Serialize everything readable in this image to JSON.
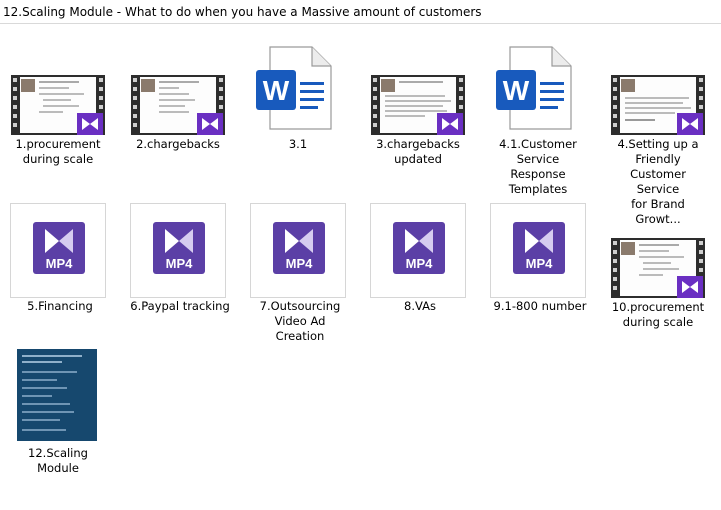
{
  "window": {
    "title": "12.Scaling Module - What to do when you have a Massive amount of customers"
  },
  "files": [
    {
      "id": "f1",
      "name": "1.procurement\nduring scale",
      "type": "video",
      "icon": "video-thumbnail-icon"
    },
    {
      "id": "f2",
      "name": "2.chargebacks",
      "type": "video",
      "icon": "video-thumbnail-icon"
    },
    {
      "id": "f3",
      "name": "3.1",
      "type": "word",
      "icon": "word-document-icon"
    },
    {
      "id": "f4",
      "name": "3.chargebacks\nupdated",
      "type": "video",
      "icon": "video-thumbnail-icon"
    },
    {
      "id": "f5",
      "name": "4.1.Customer\nService Response\nTemplates",
      "type": "word",
      "icon": "word-document-icon"
    },
    {
      "id": "f6",
      "name": "4.Setting up a\nFriendly\nCustomer Service\nfor Brand Growt...",
      "type": "video",
      "icon": "video-thumbnail-icon"
    },
    {
      "id": "f7",
      "name": "5.Financing",
      "type": "mp4",
      "icon": "mp4-file-icon",
      "badge": "MP4"
    },
    {
      "id": "f8",
      "name": "6.Paypal tracking",
      "type": "mp4",
      "icon": "mp4-file-icon",
      "badge": "MP4"
    },
    {
      "id": "f9",
      "name": "7.Outsourcing\nVideo Ad\nCreation",
      "type": "mp4",
      "icon": "mp4-file-icon",
      "badge": "MP4"
    },
    {
      "id": "f10",
      "name": "8.VAs",
      "type": "mp4",
      "icon": "mp4-file-icon",
      "badge": "MP4"
    },
    {
      "id": "f11",
      "name": "9.1-800 number",
      "type": "mp4",
      "icon": "mp4-file-icon",
      "badge": "MP4"
    },
    {
      "id": "f12",
      "name": "10.procurement\nduring scale",
      "type": "video",
      "icon": "video-thumbnail-icon"
    },
    {
      "id": "f13",
      "name": "12.Scaling\nModule",
      "type": "pdf",
      "icon": "document-thumbnail-icon"
    }
  ],
  "colors": {
    "word_blue": "#185abd",
    "mp4_purple": "#5b3fa6",
    "video_badge": "#6a2fc2",
    "film_strip": "#2d2d2d",
    "pdf_thumb": "#16486e"
  }
}
